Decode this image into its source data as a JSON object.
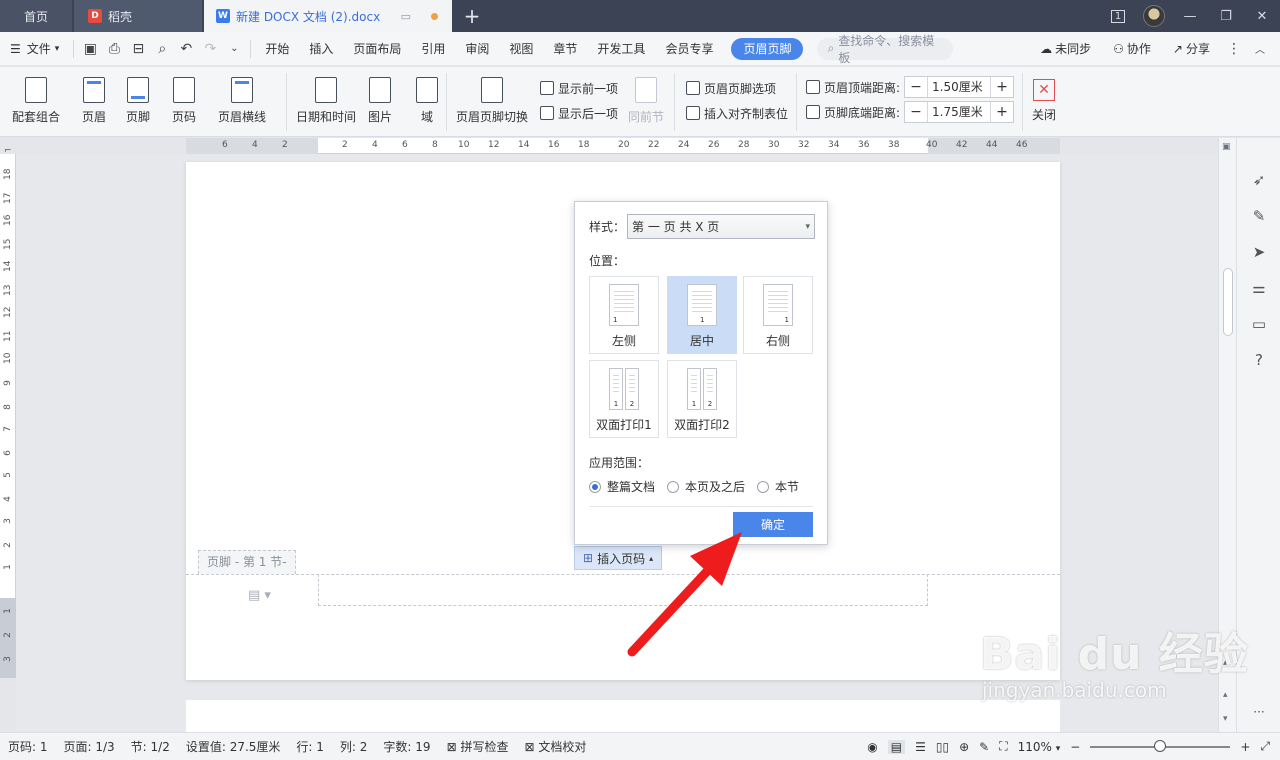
{
  "titlebar": {
    "tabs": [
      {
        "label": "首页"
      },
      {
        "label": "稻壳",
        "icon": "daoke-logo-icon"
      },
      {
        "label": "新建 DOCX 文档 (2).docx",
        "icon": "wps-writer-icon",
        "active": true
      }
    ],
    "page_indicator": "1"
  },
  "menubar": {
    "file_label": "文件",
    "tabs": [
      "开始",
      "插入",
      "页面布局",
      "引用",
      "审阅",
      "视图",
      "章节",
      "开发工具",
      "会员专享"
    ],
    "active_tab": "页眉页脚",
    "search_placeholder": "查找命令、搜索模板",
    "sync_label": "未同步",
    "collab_label": "协作",
    "share_label": "分享"
  },
  "ribbon": {
    "combo_label": "配套组合",
    "header_label": "页眉",
    "footer_label": "页脚",
    "pagenum_label": "页码",
    "header_line_label": "页眉横线",
    "datetime_label": "日期和时间",
    "picture_label": "图片",
    "field_label": "域",
    "switch_label": "页眉页脚切换",
    "show_prev_label": "显示前一项",
    "show_next_label": "显示后一项",
    "same_prev_label": "同前节",
    "options_label": "页眉页脚选项",
    "insert_tab_label": "插入对齐制表位",
    "header_top_label": "页眉顶端距离:",
    "header_top_value": "1.50厘米",
    "footer_bottom_label": "页脚底端距离:",
    "footer_bottom_value": "1.75厘米",
    "close_label": "关闭"
  },
  "document": {
    "footer_tag": "页脚 - 第 1 节-",
    "insert_pagenum_label": "插入页码"
  },
  "dialog": {
    "style_label": "样式：",
    "style_value": "第 一 页 共 X 页",
    "position_label": "位置：",
    "positions": [
      "左侧",
      "居中",
      "右侧",
      "双面打印1",
      "双面打印2"
    ],
    "selected_position": "居中",
    "scope_label": "应用范围：",
    "scope_options": [
      "整篇文档",
      "本页及之后",
      "本节"
    ],
    "selected_scope": "整篇文档",
    "ok_label": "确定"
  },
  "statusbar": {
    "page": "页码: 1",
    "pages": "页面: 1/3",
    "section": "节: 1/2",
    "setting": "设置值: 27.5厘米",
    "row": "行: 1",
    "col": "列: 2",
    "words": "字数: 19",
    "spellcheck": "拼写检查",
    "doccheck": "文档校对",
    "zoom": "110%"
  },
  "watermark": {
    "brand": "Bai du 经验",
    "url": "jingyan.baidu.com"
  },
  "colors": {
    "accent": "#4a86ea",
    "titlebar": "#3b4354",
    "arrow": "#ee1c1c"
  }
}
